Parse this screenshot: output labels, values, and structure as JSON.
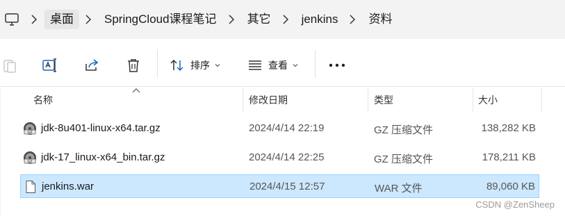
{
  "breadcrumb": {
    "items": [
      {
        "label": "桌面"
      },
      {
        "label": "SpringCloud课程笔记"
      },
      {
        "label": "其它"
      },
      {
        "label": "jenkins"
      },
      {
        "label": "资料"
      }
    ]
  },
  "toolbar": {
    "sort_label": "排序",
    "view_label": "查看"
  },
  "columns": {
    "name": "名称",
    "modified": "修改日期",
    "type": "类型",
    "size": "大小"
  },
  "files": [
    {
      "name": "jdk-8u401-linux-x64.tar.gz",
      "modified": "2024/4/14 22:19",
      "type": "GZ 压缩文件",
      "size": "138,282 KB",
      "icon": "gz-archive-icon",
      "selected": false
    },
    {
      "name": "jdk-17_linux-x64_bin.tar.gz",
      "modified": "2024/4/14 22:25",
      "type": "GZ 压缩文件",
      "size": "178,211 KB",
      "icon": "gz-archive-icon",
      "selected": false
    },
    {
      "name": "jenkins.war",
      "modified": "2024/4/15 12:57",
      "type": "WAR 文件",
      "size": "89,060 KB",
      "icon": "file-icon",
      "selected": true
    }
  ],
  "watermark": "CSDN @ZenSheep",
  "colors": {
    "selection_bg": "#cce8ff",
    "selection_border": "#99d1ff",
    "addressbar_bg": "#f3f3f3",
    "accent_icon": "#1565c0"
  }
}
